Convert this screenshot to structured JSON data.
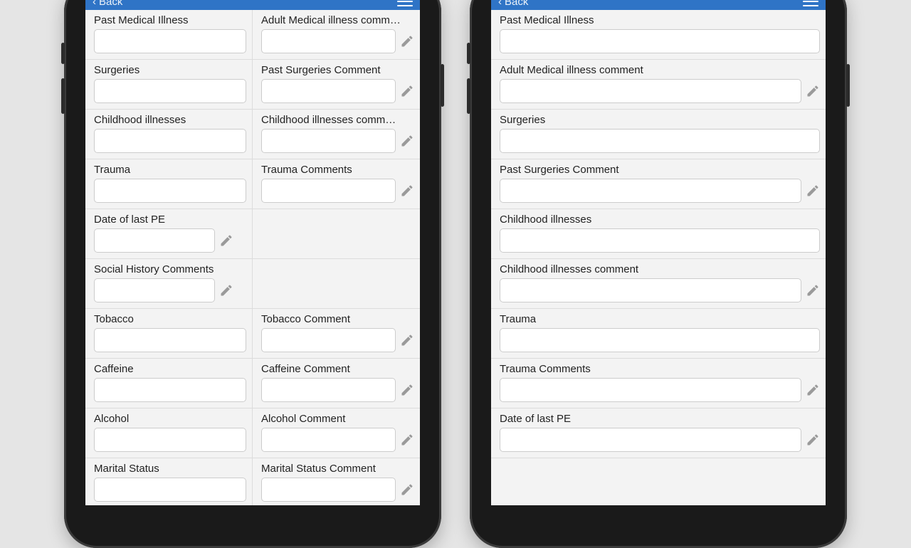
{
  "header": {
    "back_label": "Back"
  },
  "phone1": {
    "layout": "two-column",
    "rows": [
      {
        "left": {
          "label": "Past Medical Illness",
          "pencil": false
        },
        "right": {
          "label": "Adult Medical illness comm…",
          "pencil": true
        }
      },
      {
        "left": {
          "label": "Surgeries",
          "pencil": false
        },
        "right": {
          "label": "Past Surgeries Comment",
          "pencil": true
        }
      },
      {
        "left": {
          "label": "Childhood illnesses",
          "pencil": false
        },
        "right": {
          "label": "Childhood illnesses comm…",
          "pencil": true
        }
      },
      {
        "left": {
          "label": "Trauma",
          "pencil": false
        },
        "right": {
          "label": "Trauma Comments",
          "pencil": true
        }
      },
      {
        "left": {
          "label": "Date of last PE",
          "pencil": true,
          "narrow": true
        },
        "right": null
      },
      {
        "left": {
          "label": "Social History Comments",
          "pencil": true,
          "narrow": true
        },
        "right": null
      },
      {
        "left": {
          "label": "Tobacco",
          "pencil": false
        },
        "right": {
          "label": "Tobacco Comment",
          "pencil": true
        }
      },
      {
        "left": {
          "label": "Caffeine",
          "pencil": false
        },
        "right": {
          "label": "Caffeine Comment",
          "pencil": true
        }
      },
      {
        "left": {
          "label": "Alcohol",
          "pencil": false
        },
        "right": {
          "label": "Alcohol Comment",
          "pencil": true
        }
      },
      {
        "left": {
          "label": "Marital Status",
          "pencil": false
        },
        "right": {
          "label": "Marital Status Comment",
          "pencil": true
        }
      }
    ]
  },
  "phone2": {
    "layout": "single-column",
    "rows": [
      {
        "label": "Past Medical Illness",
        "pencil": false
      },
      {
        "label": "Adult Medical illness comment",
        "pencil": true
      },
      {
        "label": "Surgeries",
        "pencil": false
      },
      {
        "label": "Past Surgeries Comment",
        "pencil": true
      },
      {
        "label": "Childhood illnesses",
        "pencil": false
      },
      {
        "label": "Childhood illnesses comment",
        "pencil": true
      },
      {
        "label": "Trauma",
        "pencil": false
      },
      {
        "label": "Trauma Comments",
        "pencil": true
      },
      {
        "label": "Date of last PE",
        "pencil": true
      }
    ]
  }
}
